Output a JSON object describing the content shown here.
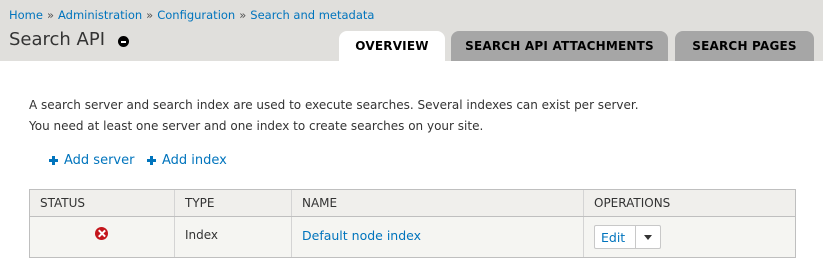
{
  "breadcrumb": {
    "items": [
      "Home",
      "Administration",
      "Configuration",
      "Search and metadata"
    ],
    "separator": "»"
  },
  "page": {
    "title": "Search API",
    "shortcut_icon": "minus-circle-icon"
  },
  "tabs": [
    {
      "label": "OVERVIEW",
      "active": true
    },
    {
      "label": "SEARCH API ATTACHMENTS",
      "active": false
    },
    {
      "label": "SEARCH PAGES",
      "active": false
    }
  ],
  "description": {
    "line1": "A search server and search index are used to execute searches. Several indexes can exist per server.",
    "line2": "You need at least one server and one index to create searches on your site."
  },
  "actions": {
    "add_server": "Add server",
    "add_index": "Add index",
    "icon": "plus-icon"
  },
  "table": {
    "headers": [
      "STATUS",
      "TYPE",
      "NAME",
      "OPERATIONS"
    ],
    "rows": [
      {
        "status_icon": "error-icon",
        "type": "Index",
        "name": "Default node index",
        "operation": "Edit"
      }
    ]
  },
  "colors": {
    "link": "#0074bd",
    "header_bg": "#e0dfdc",
    "tab_inactive": "#a6a6a6",
    "status_error": "#c4161c"
  }
}
